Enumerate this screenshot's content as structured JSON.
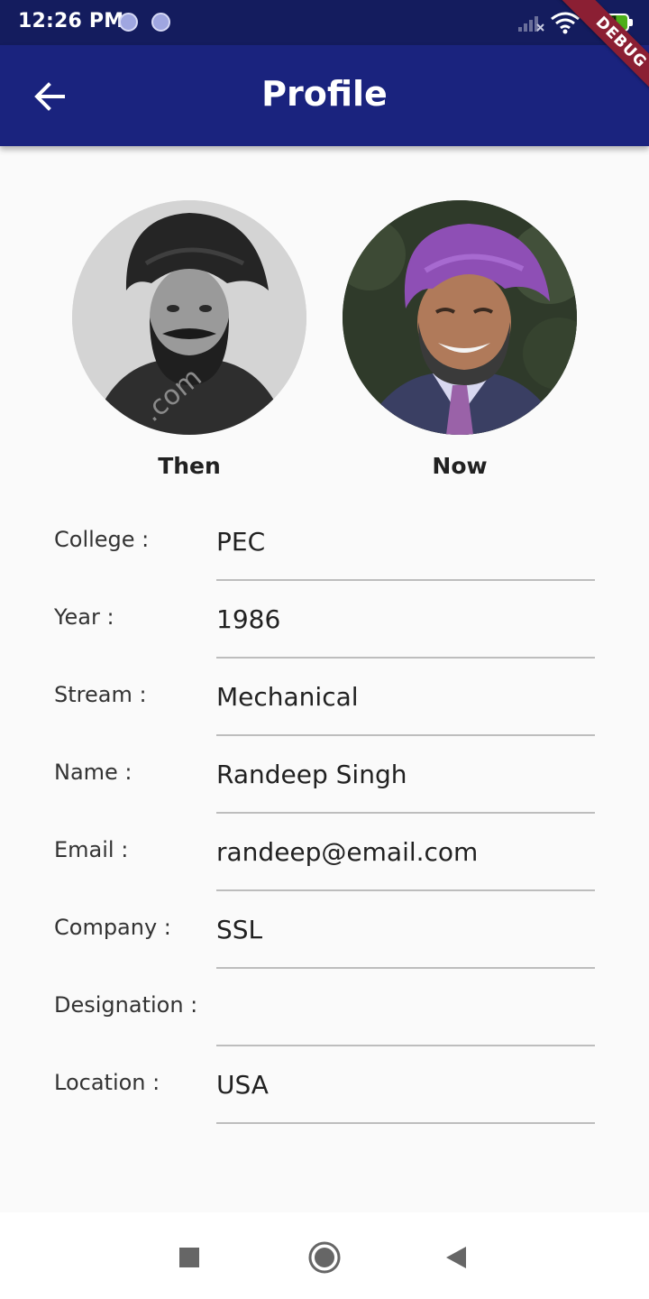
{
  "status_bar": {
    "time": "12:26 PM",
    "battery_level": "91",
    "icons": [
      "notification-dot-icon",
      "notification-dot-icon",
      "signal-icon",
      "wifi-icon",
      "battery-icon"
    ]
  },
  "app_bar": {
    "title": "Profile",
    "back_icon": "arrow-back-icon",
    "background_color": "#1a237e"
  },
  "debug_banner": "DEBUG",
  "photos": {
    "then_caption": "Then",
    "now_caption": "Now"
  },
  "profile_fields": [
    {
      "label": "College :",
      "value": "PEC"
    },
    {
      "label": "Year :",
      "value": "1986"
    },
    {
      "label": "Stream :",
      "value": "Mechanical"
    },
    {
      "label": "Name :",
      "value": "Randeep Singh"
    },
    {
      "label": "Email :",
      "value": "randeep@email.com"
    },
    {
      "label": "Company :",
      "value": "SSL"
    },
    {
      "label": "Designation :",
      "value": ""
    },
    {
      "label": "Location :",
      "value": "USA"
    }
  ],
  "nav_bar": {
    "icons": [
      "recents-square-icon",
      "home-circle-icon",
      "back-triangle-icon"
    ]
  }
}
